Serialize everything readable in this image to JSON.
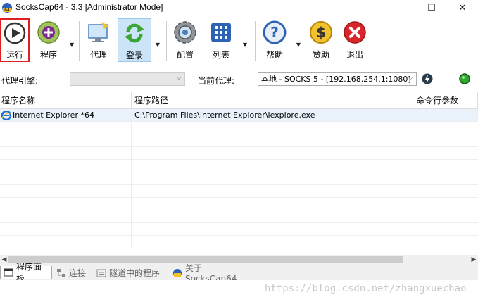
{
  "window": {
    "title": "SocksCap64 - 3.3 [Administrator Mode]",
    "minimize": "—",
    "maximize": "☐",
    "close": "✕"
  },
  "toolbar": {
    "run": "运行",
    "programs": "程序",
    "proxy": "代理",
    "login": "登录",
    "settings": "配置",
    "list": "列表",
    "help": "帮助",
    "donate": "赞助",
    "exit": "退出"
  },
  "proxybar": {
    "engine_label": "代理引擎:",
    "engine_value": "",
    "current_label": "当前代理:",
    "current_value": "本地 - SOCKS 5 - [192.168.254.1:1080]"
  },
  "grid": {
    "columns": [
      "程序名称",
      "程序路径",
      "命令行参数"
    ],
    "rows": [
      {
        "name": "Internet Explorer *64",
        "path": "C:\\Program Files\\Internet Explorer\\iexplore.exe",
        "args": ""
      }
    ]
  },
  "tabs": [
    "程序面板",
    "连接",
    "隧道中的程序",
    "关于SocksCap64"
  ],
  "watermark": "https://blog.csdn.net/zhangxuechao_",
  "colors": {
    "selection_border": "#e02020",
    "accent": "#1e6fd0"
  }
}
